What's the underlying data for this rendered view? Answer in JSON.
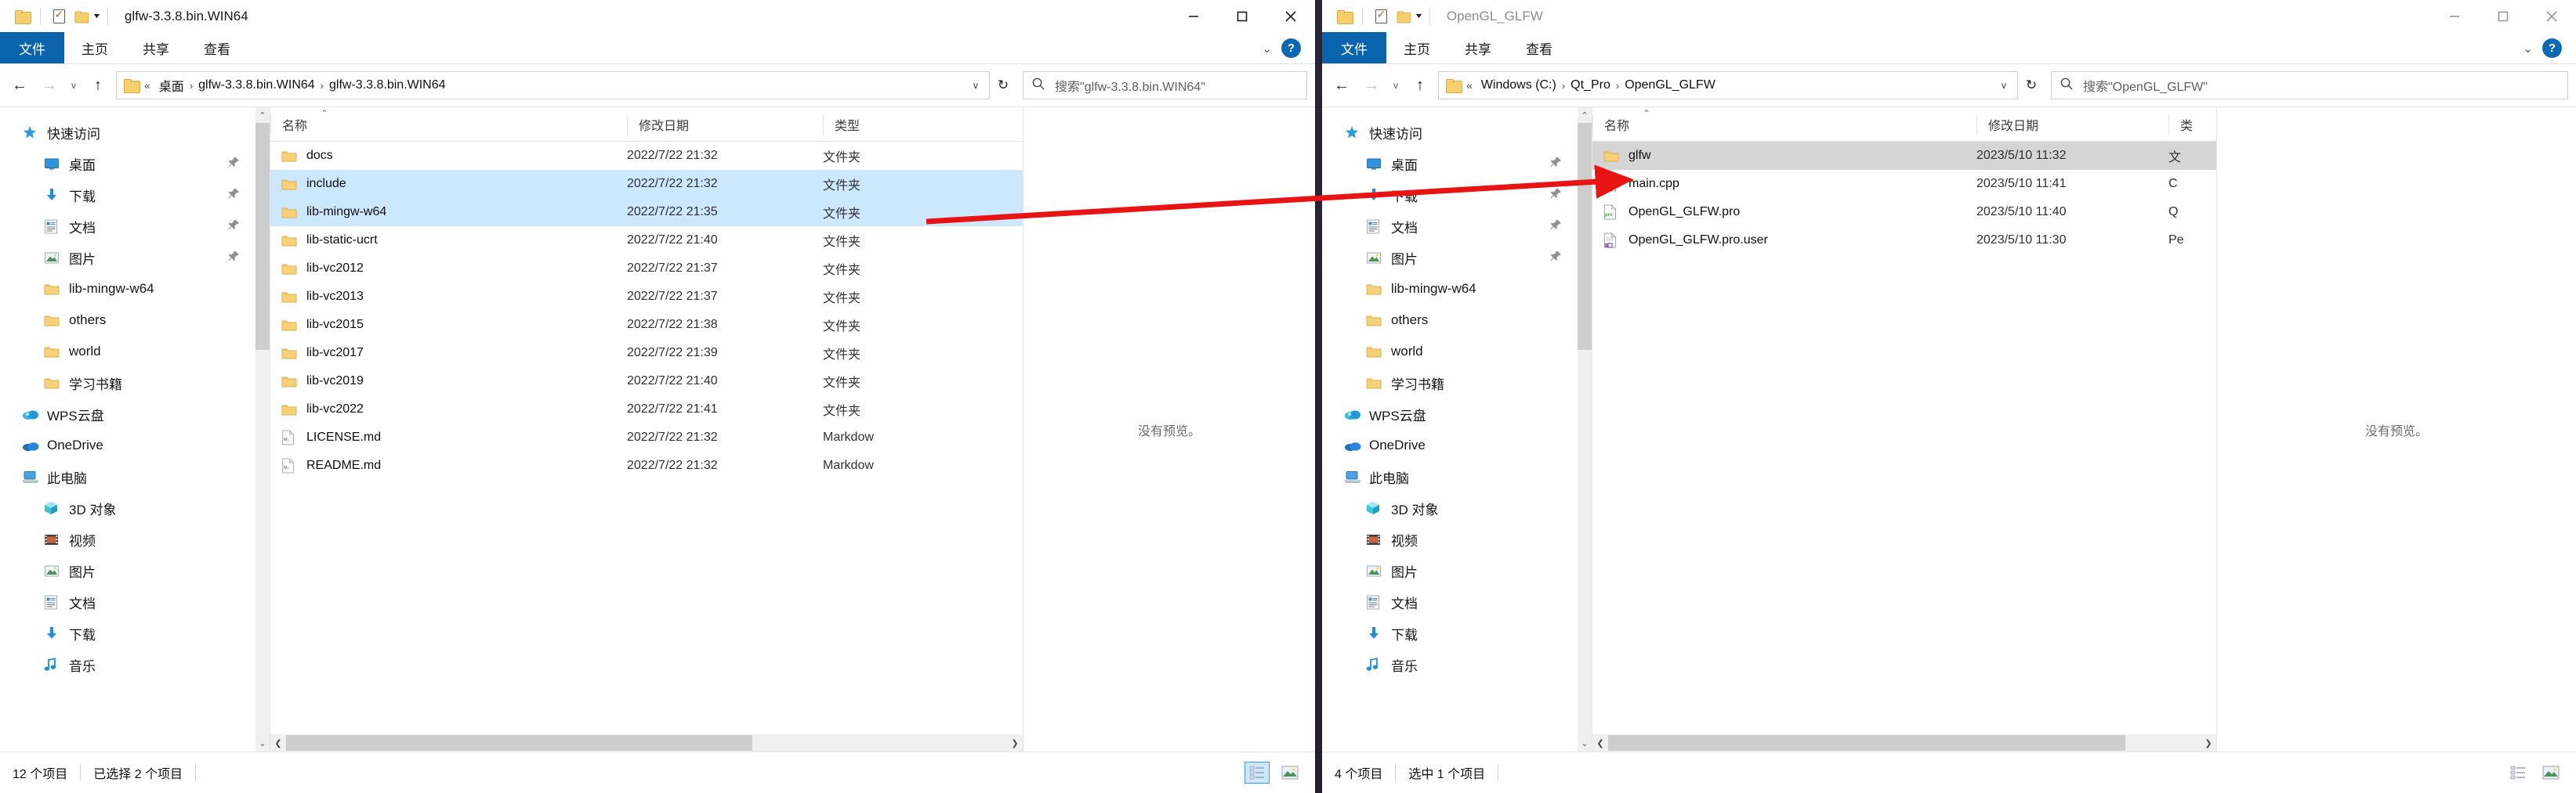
{
  "left_window": {
    "title": "glfw-3.3.8.bin.WIN64",
    "active": true,
    "quick_access_icons": [
      "folder-icon",
      "properties-icon",
      "new-folder-icon",
      "customize-caret-icon"
    ],
    "caption": {
      "minimize": "minimize-icon",
      "maximize": "maximize-icon",
      "close": "close-icon"
    },
    "ribbon": {
      "tabs": [
        {
          "label": "文件",
          "active": true
        },
        {
          "label": "主页",
          "active": false
        },
        {
          "label": "共享",
          "active": false
        },
        {
          "label": "查看",
          "active": false
        }
      ],
      "collapse": "chevron-down-icon",
      "help": "?"
    },
    "address": {
      "back": "←",
      "forward": "→",
      "recent": "v",
      "up": "↑",
      "double_chevron": "«",
      "crumbs": [
        "桌面",
        "glfw-3.3.8.bin.WIN64",
        "glfw-3.3.8.bin.WIN64"
      ],
      "dropdown": "v",
      "refresh": "↻"
    },
    "search": {
      "placeholder": "搜索\"glfw-3.3.8.bin.WIN64\""
    },
    "nav_pane": {
      "items": [
        {
          "label": "快速访问",
          "icon": "star-pin-icon",
          "indent": false,
          "pinned": false
        },
        {
          "label": "桌面",
          "icon": "desktop-icon",
          "indent": true,
          "pinned": true
        },
        {
          "label": "下载",
          "icon": "download-icon",
          "indent": true,
          "pinned": true
        },
        {
          "label": "文档",
          "icon": "documents-icon",
          "indent": true,
          "pinned": true
        },
        {
          "label": "图片",
          "icon": "pictures-icon",
          "indent": true,
          "pinned": true
        },
        {
          "label": "lib-mingw-w64",
          "icon": "folder-icon",
          "indent": true,
          "pinned": false
        },
        {
          "label": "others",
          "icon": "folder-icon",
          "indent": true,
          "pinned": false
        },
        {
          "label": "world",
          "icon": "folder-icon",
          "indent": true,
          "pinned": false
        },
        {
          "label": "学习书籍",
          "icon": "folder-icon",
          "indent": true,
          "pinned": false
        },
        {
          "label": "WPS云盘",
          "icon": "wps-cloud-icon",
          "indent": false,
          "pinned": false
        },
        {
          "label": "OneDrive",
          "icon": "onedrive-icon",
          "indent": false,
          "pinned": false
        },
        {
          "label": "此电脑",
          "icon": "this-pc-icon",
          "indent": false,
          "pinned": false
        },
        {
          "label": "3D 对象",
          "icon": "3d-objects-icon",
          "indent": true,
          "pinned": false
        },
        {
          "label": "视频",
          "icon": "videos-icon",
          "indent": true,
          "pinned": false
        },
        {
          "label": "图片",
          "icon": "pictures-icon",
          "indent": true,
          "pinned": false
        },
        {
          "label": "文档",
          "icon": "documents-icon",
          "indent": true,
          "pinned": false
        },
        {
          "label": "下载",
          "icon": "download-icon",
          "indent": true,
          "pinned": false
        },
        {
          "label": "音乐",
          "icon": "music-icon",
          "indent": true,
          "pinned": false
        }
      ]
    },
    "columns": [
      "名称",
      "修改日期",
      "类型"
    ],
    "files": [
      {
        "name": "docs",
        "date": "2022/7/22 21:32",
        "type": "文件夹",
        "icon": "folder-icon",
        "selected": false
      },
      {
        "name": "include",
        "date": "2022/7/22 21:32",
        "type": "文件夹",
        "icon": "folder-icon",
        "selected": true
      },
      {
        "name": "lib-mingw-w64",
        "date": "2022/7/22 21:35",
        "type": "文件夹",
        "icon": "folder-icon",
        "selected": true
      },
      {
        "name": "lib-static-ucrt",
        "date": "2022/7/22 21:40",
        "type": "文件夹",
        "icon": "folder-icon",
        "selected": false
      },
      {
        "name": "lib-vc2012",
        "date": "2022/7/22 21:37",
        "type": "文件夹",
        "icon": "folder-icon",
        "selected": false
      },
      {
        "name": "lib-vc2013",
        "date": "2022/7/22 21:37",
        "type": "文件夹",
        "icon": "folder-icon",
        "selected": false
      },
      {
        "name": "lib-vc2015",
        "date": "2022/7/22 21:38",
        "type": "文件夹",
        "icon": "folder-icon",
        "selected": false
      },
      {
        "name": "lib-vc2017",
        "date": "2022/7/22 21:39",
        "type": "文件夹",
        "icon": "folder-icon",
        "selected": false
      },
      {
        "name": "lib-vc2019",
        "date": "2022/7/22 21:40",
        "type": "文件夹",
        "icon": "folder-icon",
        "selected": false
      },
      {
        "name": "lib-vc2022",
        "date": "2022/7/22 21:41",
        "type": "文件夹",
        "icon": "folder-icon",
        "selected": false
      },
      {
        "name": "LICENSE.md",
        "date": "2022/7/22 21:32",
        "type": "Markdow",
        "icon": "markdown-file-icon",
        "selected": false
      },
      {
        "name": "README.md",
        "date": "2022/7/22 21:32",
        "type": "Markdow",
        "icon": "markdown-file-icon",
        "selected": false
      }
    ],
    "preview": {
      "text": "没有预览。"
    },
    "status": {
      "count": "12 个项目",
      "selection": "已选择 2 个项目"
    },
    "view_buttons": {
      "details": "details-view-icon",
      "large_icons": "large-icons-view-icon"
    }
  },
  "right_window": {
    "title": "OpenGL_GLFW",
    "active": false,
    "caption": {
      "minimize": "minimize-icon",
      "maximize": "maximize-icon",
      "close": "close-icon"
    },
    "ribbon": {
      "tabs": [
        {
          "label": "文件",
          "active": true
        },
        {
          "label": "主页",
          "active": false
        },
        {
          "label": "共享",
          "active": false
        },
        {
          "label": "查看",
          "active": false
        }
      ],
      "collapse": "chevron-down-icon",
      "help": "?"
    },
    "address": {
      "back": "←",
      "forward": "→",
      "recent": "v",
      "up": "↑",
      "double_chevron": "«",
      "crumbs": [
        "Windows (C:)",
        "Qt_Pro",
        "OpenGL_GLFW"
      ],
      "dropdown": "v",
      "refresh": "↻"
    },
    "search": {
      "placeholder": "搜索\"OpenGL_GLFW\""
    },
    "nav_pane": {
      "items": [
        {
          "label": "快速访问",
          "icon": "star-pin-icon",
          "indent": false,
          "pinned": false
        },
        {
          "label": "桌面",
          "icon": "desktop-icon",
          "indent": true,
          "pinned": true
        },
        {
          "label": "下载",
          "icon": "download-icon",
          "indent": true,
          "pinned": true
        },
        {
          "label": "文档",
          "icon": "documents-icon",
          "indent": true,
          "pinned": true
        },
        {
          "label": "图片",
          "icon": "pictures-icon",
          "indent": true,
          "pinned": true
        },
        {
          "label": "lib-mingw-w64",
          "icon": "folder-icon",
          "indent": true,
          "pinned": false
        },
        {
          "label": "others",
          "icon": "folder-icon",
          "indent": true,
          "pinned": false
        },
        {
          "label": "world",
          "icon": "folder-icon",
          "indent": true,
          "pinned": false
        },
        {
          "label": "学习书籍",
          "icon": "folder-icon",
          "indent": true,
          "pinned": false
        },
        {
          "label": "WPS云盘",
          "icon": "wps-cloud-icon",
          "indent": false,
          "pinned": false
        },
        {
          "label": "OneDrive",
          "icon": "onedrive-icon",
          "indent": false,
          "pinned": false
        },
        {
          "label": "此电脑",
          "icon": "this-pc-icon",
          "indent": false,
          "pinned": false
        },
        {
          "label": "3D 对象",
          "icon": "3d-objects-icon",
          "indent": true,
          "pinned": false
        },
        {
          "label": "视频",
          "icon": "videos-icon",
          "indent": true,
          "pinned": false
        },
        {
          "label": "图片",
          "icon": "pictures-icon",
          "indent": true,
          "pinned": false
        },
        {
          "label": "文档",
          "icon": "documents-icon",
          "indent": true,
          "pinned": false
        },
        {
          "label": "下载",
          "icon": "download-icon",
          "indent": true,
          "pinned": false
        },
        {
          "label": "音乐",
          "icon": "music-icon",
          "indent": true,
          "pinned": false
        }
      ]
    },
    "columns": [
      "名称",
      "修改日期",
      "类"
    ],
    "files": [
      {
        "name": "glfw",
        "date": "2023/5/10 11:32",
        "type": "文",
        "icon": "folder-icon",
        "selected": true
      },
      {
        "name": "main.cpp",
        "date": "2023/5/10 11:41",
        "type": "C",
        "icon": "cpp-file-icon",
        "selected": false
      },
      {
        "name": "OpenGL_GLFW.pro",
        "date": "2023/5/10 11:40",
        "type": "Q",
        "icon": "pro-file-icon",
        "selected": false
      },
      {
        "name": "OpenGL_GLFW.pro.user",
        "date": "2023/5/10 11:30",
        "type": "Pe",
        "icon": "prouser-file-icon",
        "selected": false
      }
    ],
    "preview": {
      "text": "没有预览。"
    },
    "status": {
      "count": "4 个项目",
      "selection": "选中 1 个项目"
    },
    "view_buttons": {
      "details": "details-view-icon",
      "large_icons": "large-icons-view-icon"
    }
  },
  "annotation": {
    "arrow_color": "#e81313",
    "description": "red-arrow-from-left-selection-to-glfw-folder"
  }
}
